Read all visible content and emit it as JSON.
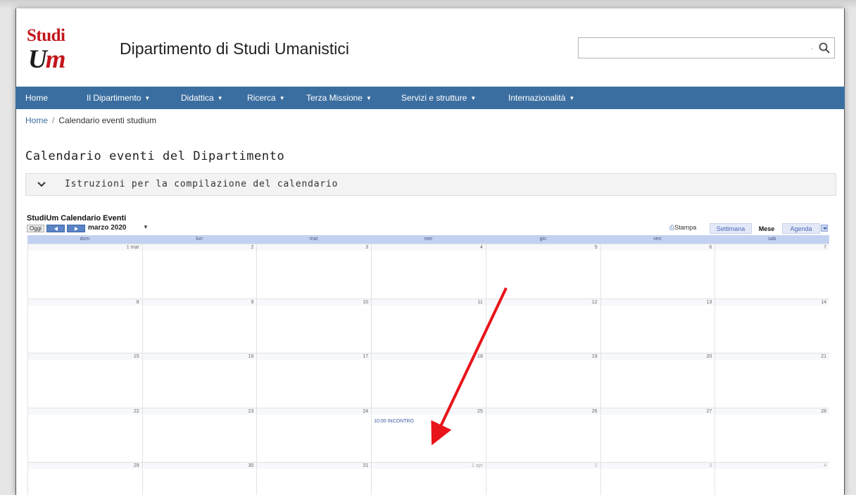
{
  "logo": {
    "top_text": "Studi",
    "bottom_text_1": "U",
    "bottom_text_2": "m"
  },
  "site_title": "Dipartimento di Studi Umanistici",
  "search": {
    "placeholder": "",
    "dot": "·"
  },
  "nav": [
    {
      "label": "Home",
      "dropdown": false
    },
    {
      "label": "Il Dipartimento",
      "dropdown": true
    },
    {
      "label": "Didattica",
      "dropdown": true
    },
    {
      "label": "Ricerca",
      "dropdown": true
    },
    {
      "label": "Terza Missione",
      "dropdown": true
    },
    {
      "label": "Servizi e strutture",
      "dropdown": true
    },
    {
      "label": "Internazionalità",
      "dropdown": true
    }
  ],
  "breadcrumb": {
    "home": "Home",
    "separator": "/",
    "current": "Calendario eventi studium"
  },
  "page_heading": "Calendario eventi del Dipartimento",
  "accordion": {
    "label": "Istruzioni per la compilazione del calendario"
  },
  "calendar": {
    "title": "StudiUm Calendario Eventi",
    "today_label": "Oggi",
    "month_label": "marzo 2020",
    "print_label": "Stampa",
    "tabs": [
      {
        "label": "Settimana",
        "active": false
      },
      {
        "label": "Mese",
        "active": true
      },
      {
        "label": "Agenda",
        "active": false
      }
    ],
    "weekdays": [
      "dom",
      "lun",
      "mar",
      "mer",
      "gio",
      "ven",
      "sab"
    ],
    "weeks": [
      [
        "1 mar",
        "2",
        "3",
        "4",
        "5",
        "6",
        "7"
      ],
      [
        "8",
        "9",
        "10",
        "11",
        "12",
        "13",
        "14"
      ],
      [
        "15",
        "16",
        "17",
        "18",
        "19",
        "20",
        "21"
      ],
      [
        "22",
        "23",
        "24",
        "25",
        "26",
        "27",
        "28"
      ],
      [
        "29",
        "30",
        "31",
        "1 apr",
        "2",
        "3",
        "4"
      ]
    ],
    "other_month_from_week4_col3": true,
    "event": {
      "week": 3,
      "day": 3,
      "text": "10:00 INCONTRO"
    }
  },
  "colors": {
    "navbar": "#3b6ea0",
    "logo_red": "#c4161c",
    "arrow": "#e8141a",
    "grid_border": "#c3d1f0"
  },
  "icons": [
    "search-icon",
    "chevron-down-icon",
    "print-icon",
    "arrow-left-icon",
    "arrow-right-icon"
  ]
}
